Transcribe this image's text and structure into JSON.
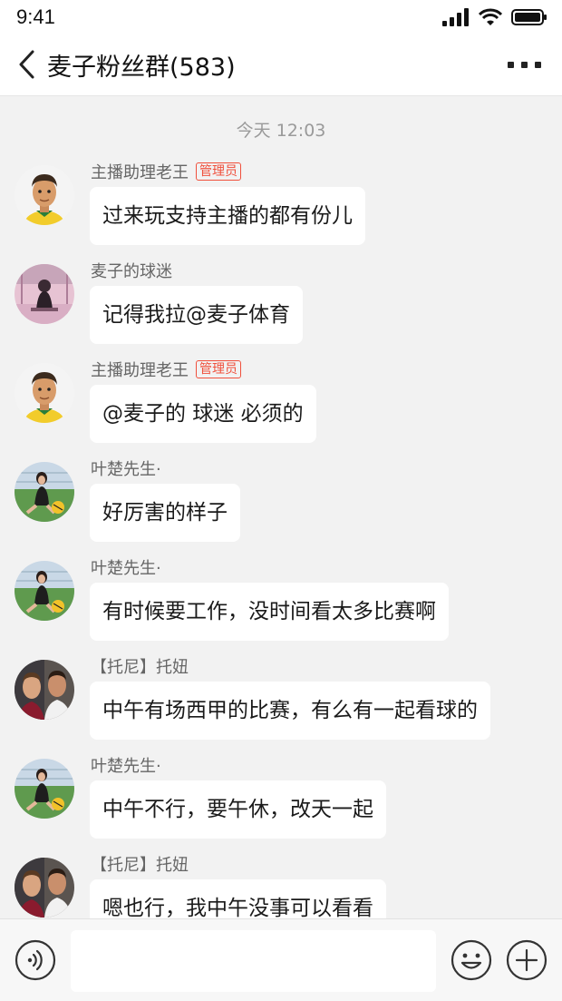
{
  "status_bar": {
    "time": "9:41",
    "signal_icon": "signal-icon",
    "wifi_icon": "wifi-icon",
    "battery_icon": "battery-icon"
  },
  "header": {
    "title": "麦子粉丝群(583)",
    "back_icon": "chevron-left-icon",
    "more_icon": "more-icon"
  },
  "chat": {
    "time_divider": "今天 12:03",
    "messages": [
      {
        "sender": "主播助理老王",
        "badge": "管理员",
        "text": "过来玩支持主播的都有份儿",
        "avatar": "footballer-cartoon"
      },
      {
        "sender": "麦子的球迷",
        "badge": "",
        "text": "记得我拉@麦子体育",
        "avatar": "pink-photo"
      },
      {
        "sender": "主播助理老王",
        "badge": "管理员",
        "text": "@麦子的 球迷 必须的",
        "avatar": "footballer-cartoon"
      },
      {
        "sender": "叶楚先生·",
        "badge": "",
        "text": "好厉害的样子",
        "avatar": "girl-football-photo"
      },
      {
        "sender": "叶楚先生·",
        "badge": "",
        "text": "有时候要工作，没时间看太多比赛啊",
        "avatar": "girl-football-photo"
      },
      {
        "sender": "【托尼】托妞",
        "badge": "",
        "text": "中午有场西甲的比赛，有么有一起看球的",
        "avatar": "two-players-photo"
      },
      {
        "sender": "叶楚先生·",
        "badge": "",
        "text": "中午不行，要午休，改天一起",
        "avatar": "girl-football-photo"
      },
      {
        "sender": "【托尼】托妞",
        "badge": "",
        "text": "嗯也行，我中午没事可以看看",
        "avatar": "two-players-photo"
      }
    ]
  },
  "input_bar": {
    "placeholder": "",
    "voice_icon": "voice-icon",
    "emoji_icon": "emoji-icon",
    "plus_icon": "plus-icon"
  },
  "colors": {
    "background": "#f2f2f2",
    "bubble": "#ffffff",
    "admin_badge": "#f0503c",
    "timestamp": "#9a9a9a"
  }
}
